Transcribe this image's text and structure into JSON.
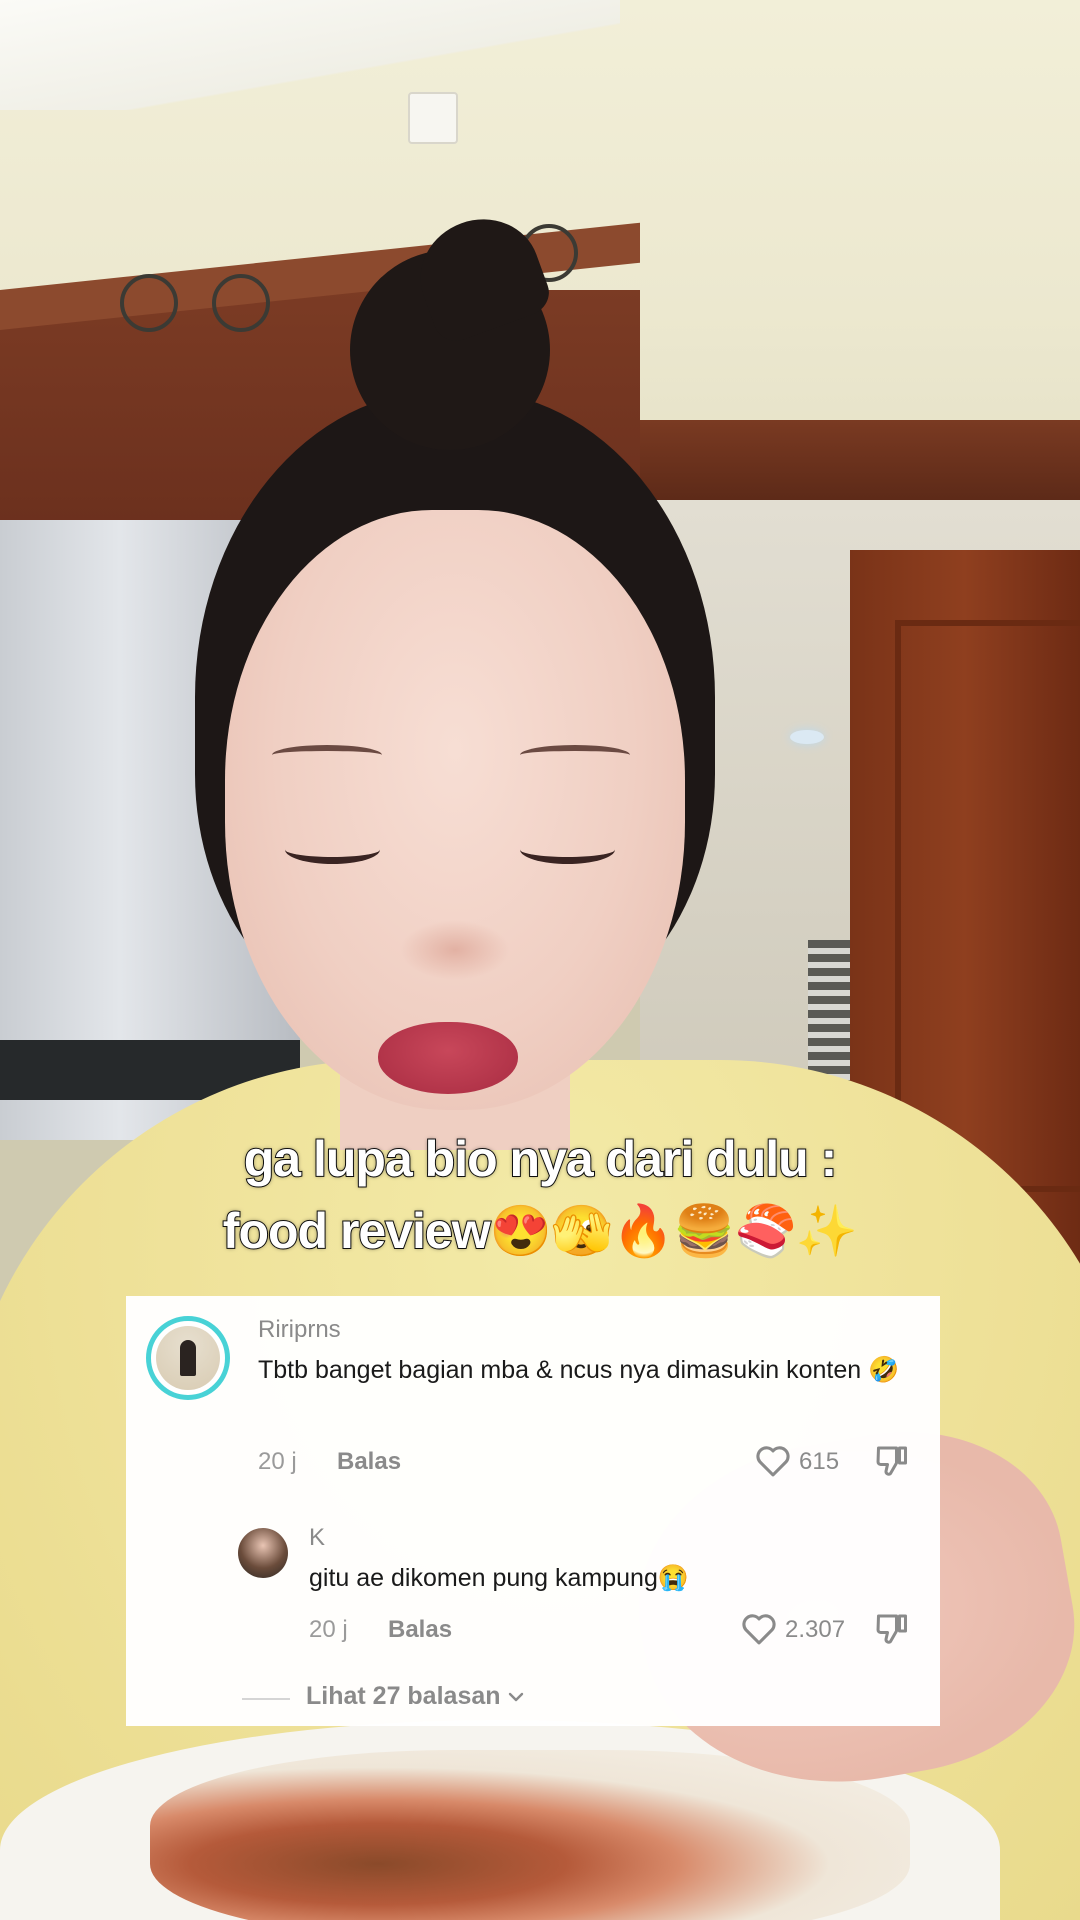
{
  "caption": {
    "line1": "ga lupa bio nya dari dulu :",
    "line2_text": "food review",
    "line2_emojis": "😍🫣🔥🍔🍣✨"
  },
  "comment": {
    "username": "Ririprns",
    "text": "Tbtb banget bagian mba & ncus nya dimasukin konten 🤣",
    "time": "20 j",
    "reply_label": "Balas",
    "likes": "615"
  },
  "reply": {
    "username": "K",
    "text": "gitu ae dikomen pung kampung😭",
    "time": "20 j",
    "reply_label": "Balas",
    "likes": "2.307"
  },
  "view_replies": "Lihat 27 balasan",
  "icons": {
    "like": "heart-outline-icon",
    "dislike": "thumbs-down-icon",
    "expand": "chevron-down-icon"
  },
  "colors": {
    "avatar_ring": "#48d2d6",
    "muted_text": "#8a8a8a"
  }
}
